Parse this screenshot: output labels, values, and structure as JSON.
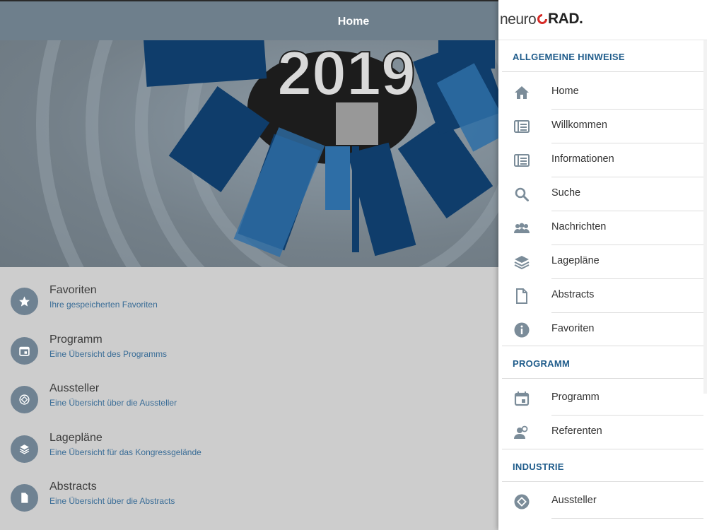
{
  "header": {
    "title": "Home"
  },
  "hero": {
    "year": "2019"
  },
  "home_items": [
    {
      "title": "Favoriten",
      "subtitle": "Ihre gespeicherten Favoriten",
      "icon": "star-icon"
    },
    {
      "title": "Programm",
      "subtitle": "Eine Übersicht des Programms",
      "icon": "calendar-icon"
    },
    {
      "title": "Aussteller",
      "subtitle": "Eine Übersicht über die Aussteller",
      "icon": "exhibitor-icon"
    },
    {
      "title": "Lagepläne",
      "subtitle": "Eine Übersicht für das Kongressgelände",
      "icon": "layers-icon"
    },
    {
      "title": "Abstracts",
      "subtitle": "Eine Übersicht über die Abstracts",
      "icon": "document-icon"
    }
  ],
  "drawer": {
    "logo_light": "neuro",
    "logo_bold": "RAD.",
    "sections": [
      {
        "heading": "ALLGEMEINE HINWEISE",
        "items": [
          {
            "label": "Home",
            "icon": "home-icon"
          },
          {
            "label": "Willkommen",
            "icon": "newspaper-icon"
          },
          {
            "label": "Informationen",
            "icon": "newspaper-icon"
          },
          {
            "label": "Suche",
            "icon": "search-icon"
          },
          {
            "label": "Nachrichten",
            "icon": "group-icon"
          },
          {
            "label": "Lagepläne",
            "icon": "layers-icon"
          },
          {
            "label": "Abstracts",
            "icon": "document-icon"
          },
          {
            "label": "Favoriten",
            "icon": "info-icon"
          }
        ]
      },
      {
        "heading": "PROGRAMM",
        "items": [
          {
            "label": "Programm",
            "icon": "calendar-icon"
          },
          {
            "label": "Referenten",
            "icon": "speakers-icon"
          }
        ]
      },
      {
        "heading": "INDUSTRIE",
        "items": [
          {
            "label": "Aussteller",
            "icon": "exhibitor-icon"
          }
        ]
      }
    ]
  },
  "colors": {
    "topbar": "#6e7f8c",
    "accent_blue": "#1f5c8b",
    "icon_grey": "#6f8292",
    "logo_red": "#d62b27"
  }
}
